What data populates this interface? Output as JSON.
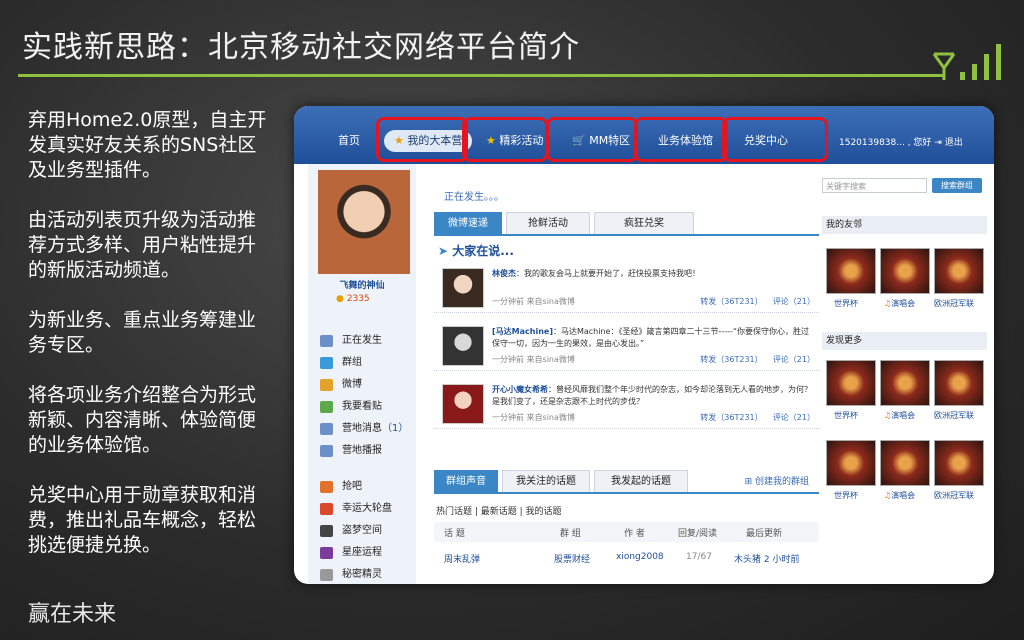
{
  "slide": {
    "title": "实践新思路：北京移动社交网络平台简介",
    "bullets": [
      "弃用Home2.0原型，自主开发真实好友关系的SNS社区及业务型插件。",
      "由活动列表页升级为活动推荐方式多样、用户粘性提升的新版活动频道。",
      "为新业务、重点业务筹建业务专区。",
      "将各项业务介绍整合为形式新颖、内容清晰、体验简便的业务体验馆。",
      "兑奖中心用于勋章获取和消费，推出礼品车概念，轻松挑选便捷兑换。"
    ],
    "footer": "赢在未来"
  },
  "site": {
    "nav": [
      "首页",
      "我的大本营",
      "精彩活动",
      "MM特区",
      "业务体验馆",
      "兑奖中心"
    ],
    "user_info": "1520139838... , 您好",
    "logout": "退出",
    "sidebar": {
      "nickname": "飞舞的神仙",
      "score": "2335",
      "menu": [
        {
          "label": "正在发生",
          "color": "#6b8fc7"
        },
        {
          "label": "群组",
          "color": "#3a9ad9"
        },
        {
          "label": "微博",
          "color": "#e2a22b"
        },
        {
          "label": "我要看贴",
          "color": "#5ca84a"
        },
        {
          "label": "营地消息",
          "count": "（1）",
          "color": "#6b8fc7"
        },
        {
          "label": "营地播报",
          "color": "#6b8fc7"
        },
        {
          "label": "抢吧",
          "color": "#e2722b"
        },
        {
          "label": "幸运大轮盘",
          "color": "#d9482b"
        },
        {
          "label": "盗梦空间",
          "color": "#444444"
        },
        {
          "label": "星座运程",
          "color": "#7a3b9a"
        },
        {
          "label": "秘密精灵",
          "color": "#999999"
        }
      ]
    },
    "content": {
      "loading": "正在发生。。。",
      "tabs": [
        "微博速递",
        "抢鲜活动",
        "疯狂兑奖"
      ],
      "everyone": "大家在说...",
      "posts": [
        {
          "author": "林俊杰",
          "text": "：我的歌友会马上就要开始了，赶快投票支持我吧！",
          "meta": "一分钟前  来自sina微博",
          "forward": "转发（36T231）",
          "comment": "评论（21）"
        },
        {
          "author": "[马达Machine]",
          "text": "：马达Machine：《圣经》箴言第四章二十三节-----“你要保守你心，胜过保守一切，因为一生的果效，是由心发出。”",
          "meta": "一分钟前  来自sina微博",
          "forward": "转发（36T231）",
          "comment": "评论（21）"
        },
        {
          "author": "开心小魔女希希",
          "text": "：曾经风靡我们整个年少时代的杂志，如今却沦落到无人看的地步，为何？是我们变了，还是杂志跟不上时代的步伐？",
          "meta": "一分钟前  来自sina微博",
          "forward": "转发（36T231）",
          "comment": "评论（21）"
        }
      ],
      "tabs2": [
        "群组声音",
        "我关注的话题",
        "我发起的话题"
      ],
      "create_group": "创建我的群组",
      "subnav": "热门话题  |  最新话题  |  我的话题",
      "table_head": [
        "话 题",
        "群 组",
        "作 者",
        "回复/阅读",
        "最后更新"
      ],
      "table_row": [
        "周末乱弹",
        "股票财经",
        "xiong2008",
        "17/67",
        "木头猪 2 小时前"
      ]
    },
    "right": {
      "search_placeholder": "关键字搜索",
      "search_button": "搜索群组",
      "friends_title": "我的友邻",
      "more_title": "发现更多",
      "thumbs": [
        "世界杯",
        "演唱会",
        "欧洲冠军联"
      ]
    }
  }
}
